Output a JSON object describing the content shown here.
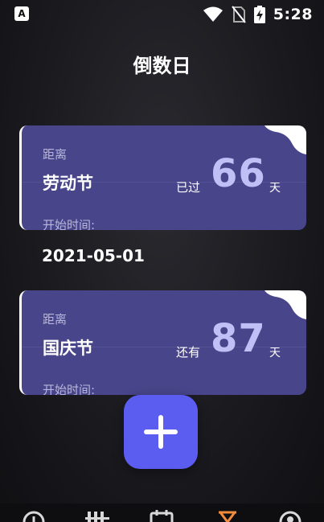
{
  "status_bar": {
    "time": "5:28",
    "app_icon_letter": "A",
    "icons": [
      "wifi-icon",
      "no-sim-icon",
      "battery-charging-icon"
    ]
  },
  "page": {
    "title": "倒数日"
  },
  "cards": [
    {
      "label": "距离",
      "name": "劳动节",
      "status": "已过",
      "count": "66",
      "unit": "天",
      "start_label": "开始时间:",
      "start_date": "2021-05-01"
    },
    {
      "label": "距离",
      "name": "国庆节",
      "status": "还有",
      "count": "87",
      "unit": "天",
      "start_label": "开始时间:"
    }
  ],
  "add_button": {
    "icon": "plus-icon"
  },
  "bottom_nav": {
    "items": [
      "clock-icon",
      "calendar-grid-icon",
      "calendar-icon",
      "hourglass-icon",
      "profile-icon"
    ],
    "active_index": 3
  },
  "colors": {
    "card": "#48458a",
    "count": "#c1c0f6",
    "accent": "#5b5cf0",
    "nav_active": "#f08a3c"
  }
}
